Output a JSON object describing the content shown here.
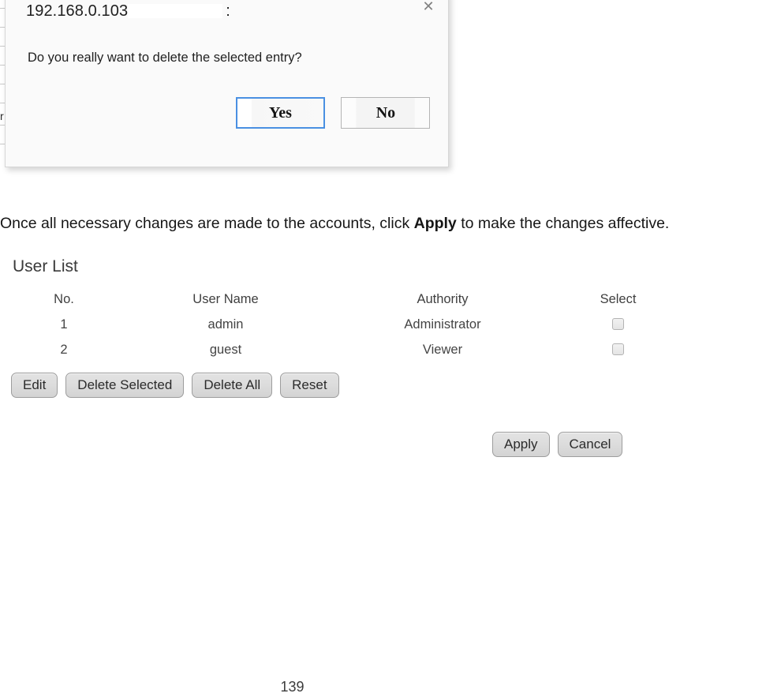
{
  "background_page": {
    "partial_glyph": "r",
    "rule_count": 8
  },
  "dialog": {
    "title_host": "192.168.0.103",
    "title_separator": ":",
    "close_icon": "close-icon",
    "message": "Do you really want to delete the selected entry?",
    "confirm_label": "Yes",
    "cancel_label": "No",
    "focus_color": "#4a90e2"
  },
  "paragraph": {
    "before": "Once all necessary changes are made to the accounts, click ",
    "emphasis": "Apply",
    "after": " to make the changes affective."
  },
  "user_list": {
    "title": "User List",
    "columns": [
      "No.",
      "User Name",
      "Authority",
      "Select"
    ],
    "rows": [
      {
        "no": "1",
        "user_name": "admin",
        "authority": "Administrator",
        "selected": false
      },
      {
        "no": "2",
        "user_name": "guest",
        "authority": "Viewer",
        "selected": false
      }
    ],
    "list_actions": [
      "Edit",
      "Delete Selected",
      "Delete All",
      "Reset"
    ],
    "form_actions": [
      "Apply",
      "Cancel"
    ]
  },
  "footer": {
    "page_number": "139"
  }
}
